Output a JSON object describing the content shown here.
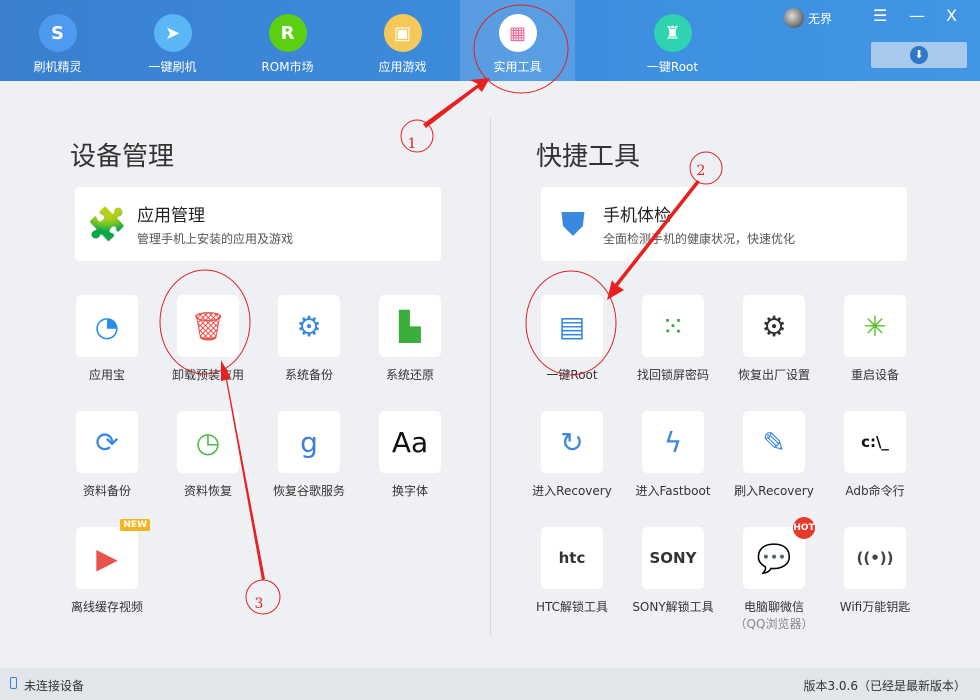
{
  "header": {
    "nav": [
      {
        "label": "刷机精灵",
        "icon": "shield-s-icon",
        "color": "#4e9af0",
        "glyph": "S"
      },
      {
        "label": "一键刷机",
        "icon": "cursor-arrow-icon",
        "color": "#5bb6f5",
        "glyph": "➤"
      },
      {
        "label": "ROM市场",
        "icon": "rom-r-icon",
        "color": "#5ccf12",
        "glyph": "R"
      },
      {
        "label": "应用游戏",
        "icon": "shopping-bag-icon",
        "color": "#f4c95a",
        "glyph": "▣"
      },
      {
        "label": "实用工具",
        "icon": "grid-icon",
        "color": "#ffffff",
        "glyph": "▦",
        "active": true
      },
      {
        "label": "一键Root",
        "icon": "android-icon",
        "color": "#2fd3b0",
        "glyph": "♜"
      }
    ],
    "user": "无界",
    "menu_icon": "☰",
    "minimize_icon": "—",
    "close_icon": "X",
    "download_icon": "⬇"
  },
  "left": {
    "title": "设备管理",
    "card": {
      "title": "应用管理",
      "subtitle": "管理手机上安装的应用及游戏",
      "icon": "puzzle-icon",
      "glyph": "🧩"
    },
    "tiles": [
      {
        "label": "应用宝",
        "icon": "yingyongbao-icon",
        "glyph": "◔",
        "color": "#2a8de8"
      },
      {
        "label": "卸载预装应用",
        "icon": "trash-icon",
        "glyph": "🗑",
        "color": "#e8534c"
      },
      {
        "label": "系统备份",
        "icon": "gear-document-icon",
        "glyph": "⚙",
        "color": "#3a88e0"
      },
      {
        "label": "系统还原",
        "icon": "restore-document-icon",
        "glyph": "▙",
        "color": "#3aae3a"
      },
      {
        "label": "资料备份",
        "icon": "sync-icon",
        "glyph": "⟳",
        "color": "#3a88e0"
      },
      {
        "label": "资料恢复",
        "icon": "history-clock-icon",
        "glyph": "◷",
        "color": "#4cb84c"
      },
      {
        "label": "恢复谷歌服务",
        "icon": "google-g-icon",
        "glyph": "g",
        "color": "#3a7fe0"
      },
      {
        "label": "换字体",
        "icon": "font-aa-icon",
        "glyph": "Aa",
        "color": "#111"
      },
      {
        "label": "离线缓存视频",
        "icon": "video-phone-icon",
        "glyph": "▶",
        "color": "#e8534c",
        "badge": "NEW"
      }
    ]
  },
  "right": {
    "title": "快捷工具",
    "card": {
      "title": "手机体检",
      "subtitle": "全面检测手机的健康状况，快速优化",
      "icon": "shield-icon",
      "glyph": "⛊"
    },
    "tiles": [
      {
        "label": "一键Root",
        "icon": "android-root-icon",
        "glyph": "▤",
        "color": "#3a88e0"
      },
      {
        "label": "找回锁屏密码",
        "icon": "pattern-lock-icon",
        "glyph": "⁙",
        "color": "#3aa83a"
      },
      {
        "label": "恢复出厂设置",
        "icon": "gears-icon",
        "glyph": "⚙",
        "color": "#333"
      },
      {
        "label": "重启设备",
        "icon": "loading-spinner-icon",
        "glyph": "✳",
        "color": "#5cc02a"
      },
      {
        "label": "进入Recovery",
        "icon": "refresh-icon",
        "glyph": "↻",
        "color": "#3a88e0"
      },
      {
        "label": "进入Fastboot",
        "icon": "lightning-icon",
        "glyph": "ϟ",
        "color": "#3a88e0"
      },
      {
        "label": "刷入Recovery",
        "icon": "tablet-pen-icon",
        "glyph": "✎",
        "color": "#3a88e0"
      },
      {
        "label": "Adb命令行",
        "icon": "terminal-icon",
        "glyph": "c:\\_",
        "color": "#111"
      },
      {
        "label": "HTC解锁工具",
        "icon": "htc-unlock-icon",
        "glyph": "htc",
        "color": "#333"
      },
      {
        "label": "SONY解锁工具",
        "icon": "sony-unlock-icon",
        "glyph": "SONY",
        "color": "#333"
      },
      {
        "label": "电脑聊微信",
        "sublabel": "（QQ浏览器）",
        "icon": "wechat-icon",
        "glyph": "💬",
        "color": "#3ab03a",
        "badge": "HOT"
      },
      {
        "label": "Wifi万能钥匙",
        "icon": "wifi-key-icon",
        "glyph": "((•))",
        "color": "#444"
      }
    ]
  },
  "annotations": {
    "marks": [
      "1",
      "2",
      "3"
    ],
    "color": "#e02020"
  },
  "footer": {
    "status": "未连接设备",
    "version": "版本3.0.6（已经是最新版本）"
  }
}
